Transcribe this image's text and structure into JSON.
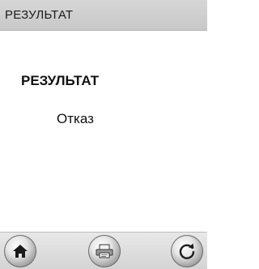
{
  "header": {
    "title": "РЕЗУЛЬТАТ"
  },
  "main": {
    "heading": "РЕЗУЛЬТАТ",
    "result": "Отказ"
  },
  "toolbar": {
    "buttons": [
      {
        "icon": "home-icon"
      },
      {
        "icon": "printer-icon"
      },
      {
        "icon": "refresh-icon"
      }
    ]
  }
}
